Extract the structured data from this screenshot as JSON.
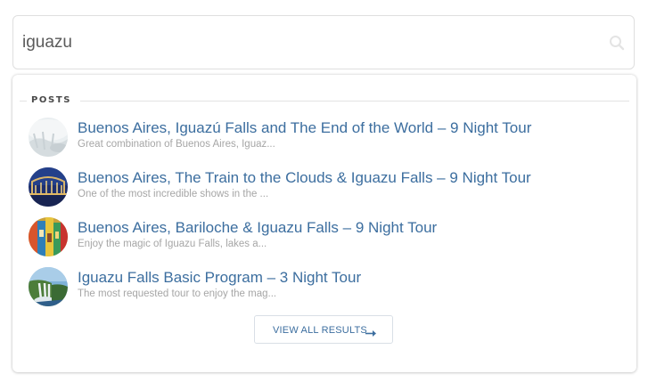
{
  "search": {
    "value": "iguazu",
    "icon": "search-icon"
  },
  "results": {
    "section_title": "POSTS",
    "items": [
      {
        "title": "Buenos Aires, Iguazú Falls and The End of the World – 9 Night Tour",
        "excerpt": "Great combination of Buenos Aires, Iguaz..."
      },
      {
        "title": "Buenos Aires, The Train to the Clouds & Iguazu Falls – 9 Night Tour",
        "excerpt": "One of the most incredible shows in the ..."
      },
      {
        "title": "Buenos Aires, Bariloche & Iguazu Falls – 9 Night Tour",
        "excerpt": "Enjoy the magic of Iguazu Falls, lakes a..."
      },
      {
        "title": "Iguazu Falls Basic Program – 3 Night Tour",
        "excerpt": "The most requested tour to enjoy the mag..."
      }
    ],
    "view_all_label": "VIEW ALL RESULTS",
    "view_all_icon": "arrow-right-icon"
  },
  "colors": {
    "link": "#3c6e9f",
    "excerpt": "#a6a6a6",
    "border": "#dfdfdf"
  }
}
